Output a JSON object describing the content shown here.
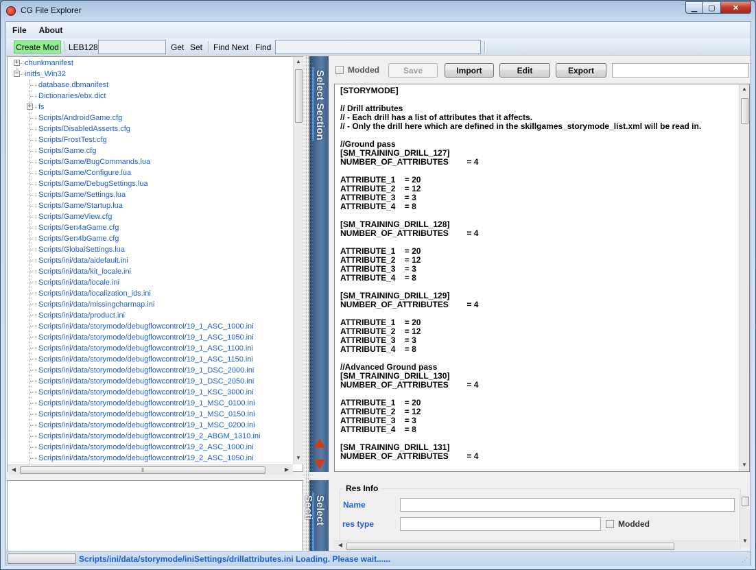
{
  "window": {
    "title": "CG File Explorer",
    "min_glyph": "▁",
    "max_glyph": "▢",
    "close_glyph": "✕"
  },
  "menu": [
    "File",
    "About"
  ],
  "toolbar": {
    "create_mod": "Create Mod",
    "leb128_label": "LEB128",
    "leb128_value": "",
    "get": "Get",
    "set": "Set",
    "find_next": "Find Next",
    "find": "Find",
    "find_value": ""
  },
  "tree": {
    "top_nodes": [
      {
        "label": "chunkmanifest",
        "expander": "+"
      },
      {
        "label": "initfs_Win32",
        "expander": "−"
      }
    ],
    "children": [
      {
        "label": "database.dbmanifest"
      },
      {
        "label": "Dictionaries/ebx.dict"
      },
      {
        "label": "fs",
        "expander": "+"
      },
      {
        "label": "Scripts/AndroidGame.cfg"
      },
      {
        "label": "Scripts/DisabledAsserts.cfg"
      },
      {
        "label": "Scripts/FrostTest.cfg"
      },
      {
        "label": "Scripts/Game.cfg"
      },
      {
        "label": "Scripts/Game/BugCommands.lua"
      },
      {
        "label": "Scripts/Game/Configure.lua"
      },
      {
        "label": "Scripts/Game/DebugSettings.lua"
      },
      {
        "label": "Scripts/Game/Settings.lua"
      },
      {
        "label": "Scripts/Game/Startup.lua"
      },
      {
        "label": "Scripts/GameView.cfg"
      },
      {
        "label": "Scripts/Gen4aGame.cfg"
      },
      {
        "label": "Scripts/Gen4bGame.cfg"
      },
      {
        "label": "Scripts/GlobalSettings.lua"
      },
      {
        "label": "Scripts/ini/data/aidefault.ini"
      },
      {
        "label": "Scripts/ini/data/kit_locale.ini"
      },
      {
        "label": "Scripts/ini/data/locale.ini"
      },
      {
        "label": "Scripts/ini/data/localization_ids.ini"
      },
      {
        "label": "Scripts/ini/data/missingcharmap.ini"
      },
      {
        "label": "Scripts/ini/data/product.ini"
      },
      {
        "label": "Scripts/ini/data/storymode/debugflowcontrol/19_1_ASC_1000.ini"
      },
      {
        "label": "Scripts/ini/data/storymode/debugflowcontrol/19_1_ASC_1050.ini"
      },
      {
        "label": "Scripts/ini/data/storymode/debugflowcontrol/19_1_ASC_1100.ini"
      },
      {
        "label": "Scripts/ini/data/storymode/debugflowcontrol/19_1_ASC_1150.ini"
      },
      {
        "label": "Scripts/ini/data/storymode/debugflowcontrol/19_1_DSC_2000.ini"
      },
      {
        "label": "Scripts/ini/data/storymode/debugflowcontrol/19_1_DSC_2050.ini"
      },
      {
        "label": "Scripts/ini/data/storymode/debugflowcontrol/19_1_KSC_3000.ini"
      },
      {
        "label": "Scripts/ini/data/storymode/debugflowcontrol/19_1_MSC_0100.ini"
      },
      {
        "label": "Scripts/ini/data/storymode/debugflowcontrol/19_1_MSC_0150.ini"
      },
      {
        "label": "Scripts/ini/data/storymode/debugflowcontrol/19_1_MSC_0200.ini"
      },
      {
        "label": "Scripts/ini/data/storymode/debugflowcontrol/19_2_ABGM_1310.ini"
      },
      {
        "label": "Scripts/ini/data/storymode/debugflowcontrol/19_2_ASC_1000.ini"
      },
      {
        "label": "Scripts/ini/data/storymode/debugflowcontrol/19_2_ASC_1050.ini"
      }
    ]
  },
  "scroll_glyphs": {
    "up": "▲",
    "down": "▼",
    "left": "◀",
    "right": "▶",
    "grip": "⦀"
  },
  "section": {
    "label_top": "Select Section",
    "label_bottom": "Select Secti"
  },
  "editor_toolbar": {
    "modded": "Modded",
    "save": "Save",
    "import": "Import",
    "edit": "Edit",
    "export": "Export",
    "search_value": ""
  },
  "editor": {
    "lines": [
      "[STORYMODE]",
      "",
      "// Drill attributes",
      "// - Each drill has a list of attributes that it affects.",
      "// - Only the drill here which are defined in the skillgames_storymode_list.xml will be read in.",
      "",
      "//Ground pass",
      "[SM_TRAINING_DRILL_127]",
      "NUMBER_OF_ATTRIBUTES        = 4",
      "",
      "ATTRIBUTE_1    = 20",
      "ATTRIBUTE_2    = 12",
      "ATTRIBUTE_3    = 3",
      "ATTRIBUTE_4    = 8",
      "",
      "[SM_TRAINING_DRILL_128]",
      "NUMBER_OF_ATTRIBUTES        = 4",
      "",
      "ATTRIBUTE_1    = 20",
      "ATTRIBUTE_2    = 12",
      "ATTRIBUTE_3    = 3",
      "ATTRIBUTE_4    = 8",
      "",
      "[SM_TRAINING_DRILL_129]",
      "NUMBER_OF_ATTRIBUTES        = 4",
      "",
      "ATTRIBUTE_1    = 20",
      "ATTRIBUTE_2    = 12",
      "ATTRIBUTE_3    = 3",
      "ATTRIBUTE_4    = 8",
      "",
      "//Advanced Ground pass",
      "[SM_TRAINING_DRILL_130]",
      "NUMBER_OF_ATTRIBUTES        = 4",
      "",
      "ATTRIBUTE_1    = 20",
      "ATTRIBUTE_2    = 12",
      "ATTRIBUTE_3    = 3",
      "ATTRIBUTE_4    = 8",
      "",
      "[SM_TRAINING_DRILL_131]",
      "NUMBER_OF_ATTRIBUTES        = 4"
    ]
  },
  "res_info": {
    "title": "Res Info",
    "name_label": "Name",
    "name_value": "",
    "type_label": "res type",
    "type_value": "",
    "modded": "Modded"
  },
  "status": {
    "text": "Scripts/ini/data/storymode/iniSettings/drillattributes.ini Loading. Please wait......",
    "grip": "⋰"
  },
  "colors": {
    "link": "#1e5fd6",
    "create_mod_bg": "#90ee90",
    "arrow": "#d23a1a"
  }
}
